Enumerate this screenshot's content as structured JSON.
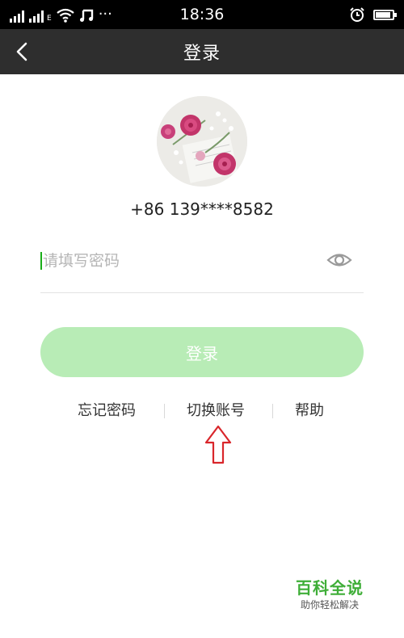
{
  "status_bar": {
    "time": "18:36",
    "icons": [
      "signal-icon",
      "signal-icon",
      "wifi-icon",
      "music-icon",
      "more-icon",
      "alarm-icon",
      "battery-icon"
    ],
    "network_label": "E",
    "more": "···"
  },
  "header": {
    "title": "登录"
  },
  "account": {
    "phone": "+86 139****8582"
  },
  "password_field": {
    "placeholder": "请填写密码",
    "value": ""
  },
  "login_button": {
    "label": "登录"
  },
  "links": {
    "forgot_password": "忘记密码",
    "switch_account": "切换账号",
    "help": "帮助"
  },
  "watermark": {
    "title": "百科全说",
    "subtitle": "助你轻松解决"
  },
  "colors": {
    "status_bar_bg": "#000000",
    "title_bar_bg": "#2e2e2e",
    "accent_green": "#1aad19",
    "login_button_disabled": "#b8ecb6",
    "annotation_arrow": "#d9262b",
    "watermark_green": "#3fae38"
  }
}
